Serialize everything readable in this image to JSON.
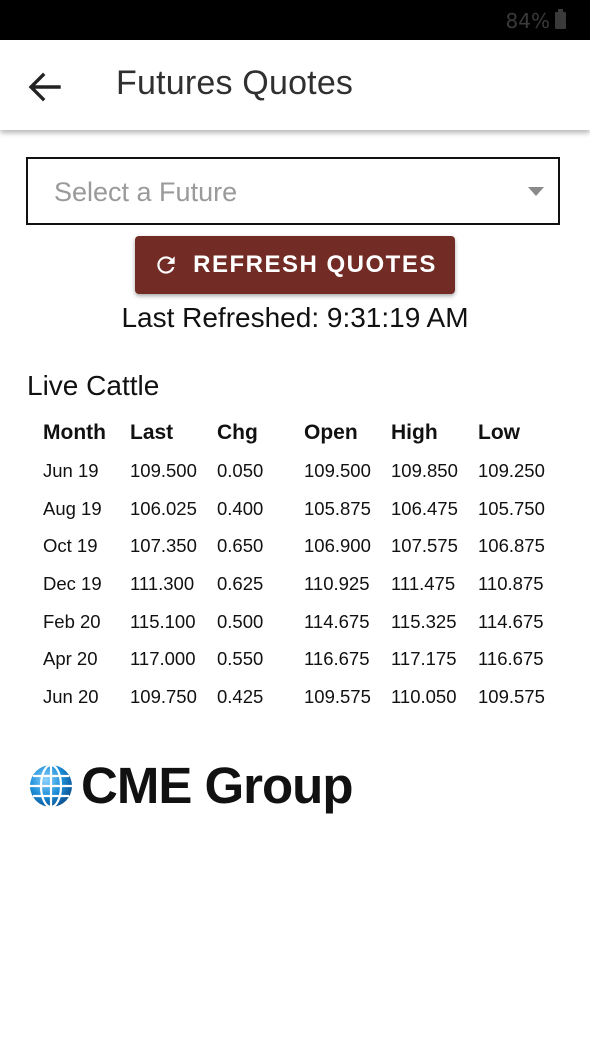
{
  "status_bar": {
    "battery": "84%",
    "battery_icon": "battery-icon"
  },
  "app_bar": {
    "back_icon": "arrow-left-icon",
    "title": "Futures Quotes"
  },
  "future_select": {
    "placeholder": "Select a Future",
    "caret_icon": "caret-down-icon"
  },
  "refresh_button": {
    "icon": "refresh-icon",
    "label": "REFRESH QUOTES",
    "color": "#722b25"
  },
  "last_refreshed": "Last Refreshed: 9:31:19 AM",
  "quotes": {
    "title": "Live Cattle",
    "columns": [
      "Month",
      "Last",
      "Chg",
      "Open",
      "High",
      "Low"
    ],
    "rows": [
      [
        "Jun 19",
        "109.500",
        "0.050",
        "109.500",
        "109.850",
        "109.250"
      ],
      [
        "Aug 19",
        "106.025",
        "0.400",
        "105.875",
        "106.475",
        "105.750"
      ],
      [
        "Oct 19",
        "107.350",
        "0.650",
        "106.900",
        "107.575",
        "106.875"
      ],
      [
        "Dec 19",
        "111.300",
        "0.625",
        "110.925",
        "111.475",
        "110.875"
      ],
      [
        "Feb 20",
        "115.100",
        "0.500",
        "114.675",
        "115.325",
        "114.675"
      ],
      [
        "Apr 20",
        "117.000",
        "0.550",
        "116.675",
        "117.175",
        "116.675"
      ],
      [
        "Jun 20",
        "109.750",
        "0.425",
        "109.575",
        "110.050",
        "109.575"
      ]
    ]
  },
  "logo": {
    "text": "CME Group",
    "icon": "globe-icon",
    "globe_color": "#1c8fd8"
  }
}
